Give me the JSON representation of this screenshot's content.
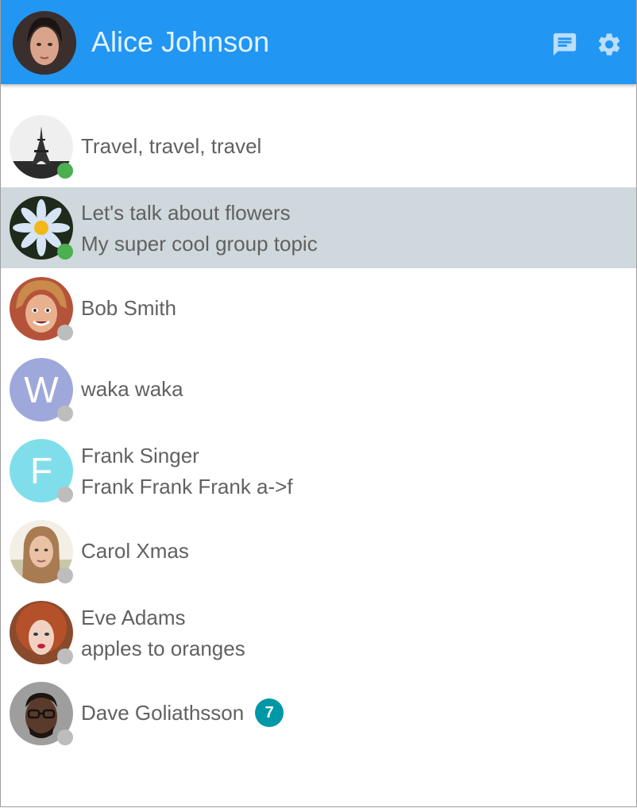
{
  "header": {
    "title": "Alice Johnson",
    "avatar_icon": "user-avatar-photo",
    "chat_icon": "chat-icon",
    "settings_icon": "gear-icon",
    "color": "#2196f3"
  },
  "contacts": [
    {
      "name": "Travel, travel, travel",
      "subtitle": "",
      "status": "online",
      "avatar": "eiffel-tower-photo"
    },
    {
      "name": "Let's talk about flowers",
      "subtitle": "My super cool group topic",
      "status": "online",
      "avatar": "flower-photo",
      "selected": true
    },
    {
      "name": "Bob Smith",
      "subtitle": "",
      "status": "offline",
      "avatar": "man-photo"
    },
    {
      "name": "waka waka",
      "subtitle": "",
      "status": "offline",
      "avatar_letter": "W",
      "avatar_color": "#9fa8da"
    },
    {
      "name": "Frank Singer",
      "subtitle": "Frank Frank Frank a->f",
      "status": "offline",
      "avatar_letter": "F",
      "avatar_color": "#80deea"
    },
    {
      "name": "Carol Xmas",
      "subtitle": "",
      "status": "offline",
      "avatar": "woman-photo"
    },
    {
      "name": "Eve Adams",
      "subtitle": "apples to oranges",
      "status": "offline",
      "avatar": "woman-red-hair-photo"
    },
    {
      "name": "Dave Goliathsson",
      "subtitle": "",
      "status": "offline",
      "avatar": "man-glasses-photo",
      "unread": "7"
    }
  ],
  "colors": {
    "online": "#4caf50",
    "offline": "#bdbdbd",
    "selected": "#cfd8dc",
    "badge": "#0097a7"
  }
}
